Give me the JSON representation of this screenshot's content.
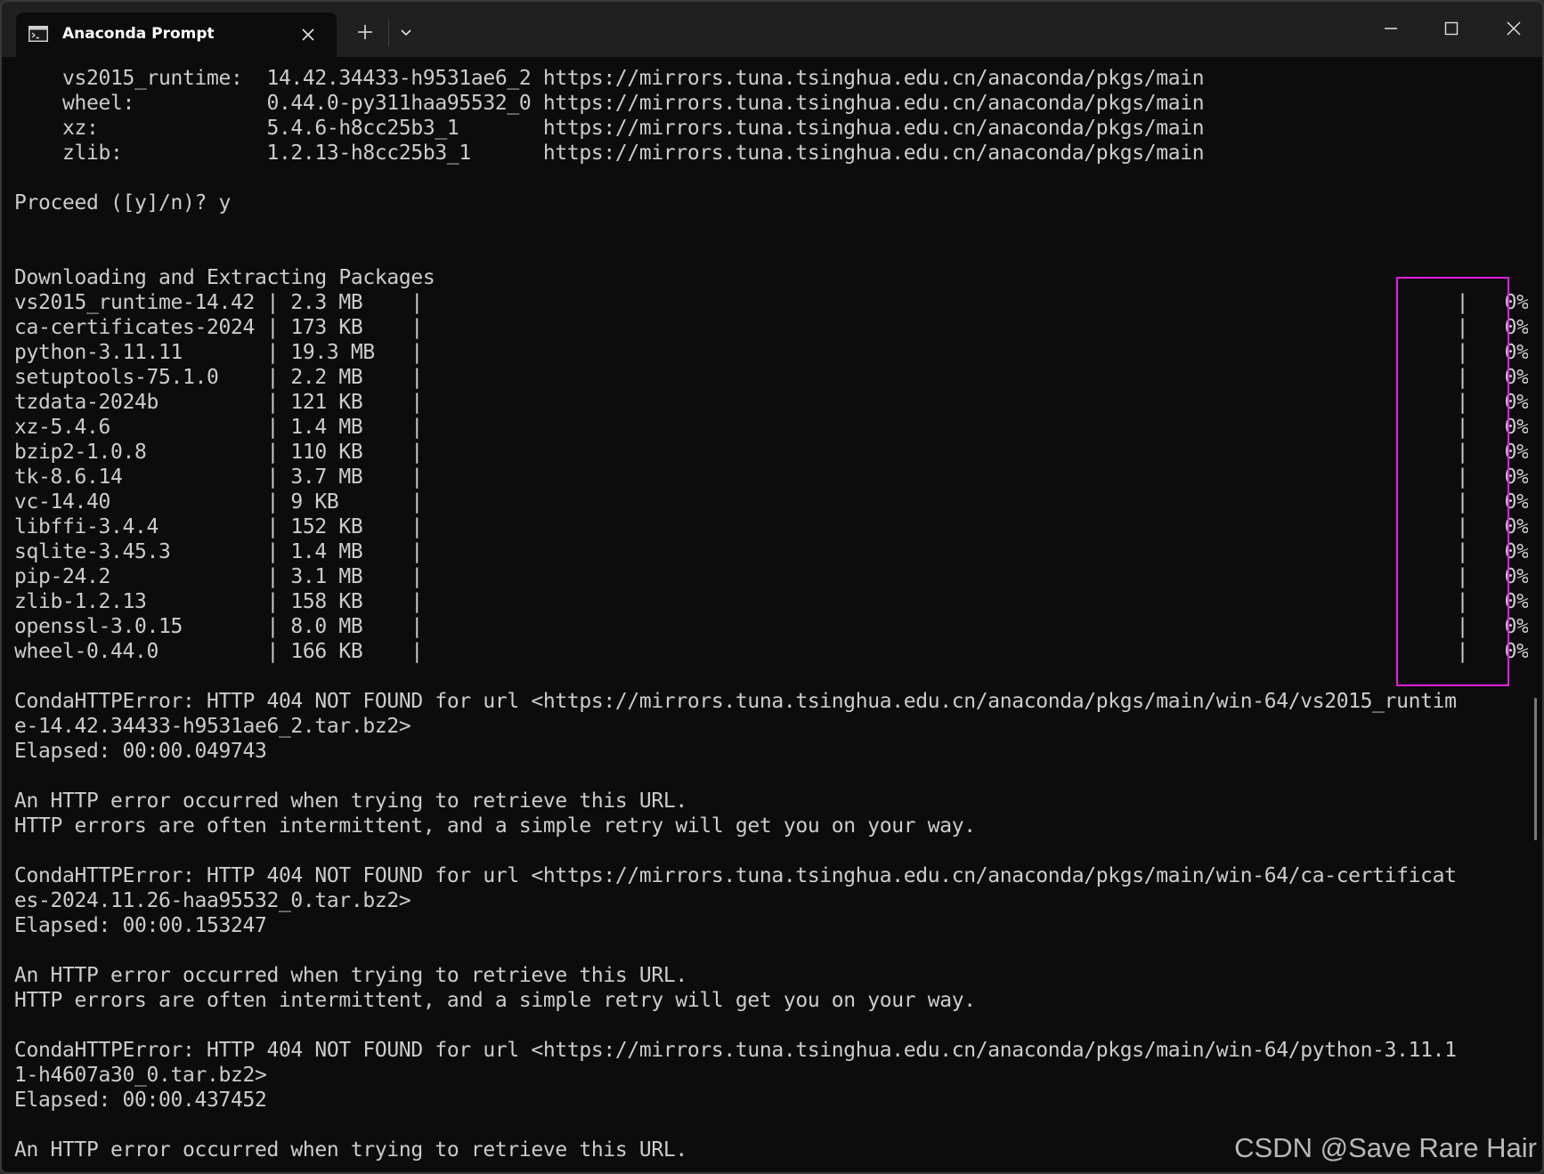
{
  "window": {
    "tab_title": "Anaconda Prompt",
    "tab_icon": "terminal-icon",
    "buttons": {
      "close_tab": "close-icon",
      "new_tab": "plus-icon",
      "dropdown": "chevron-down-icon",
      "minimize": "minimize-icon",
      "maximize": "maximize-icon",
      "close_window": "close-icon"
    }
  },
  "terminal": {
    "lines": [
      "    vs2015_runtime:  14.42.34433-h9531ae6_2 https://mirrors.tuna.tsinghua.edu.cn/anaconda/pkgs/main",
      "    wheel:           0.44.0-py311haa95532_0 https://mirrors.tuna.tsinghua.edu.cn/anaconda/pkgs/main",
      "    xz:              5.4.6-h8cc25b3_1       https://mirrors.tuna.tsinghua.edu.cn/anaconda/pkgs/main",
      "    zlib:            1.2.13-h8cc25b3_1      https://mirrors.tuna.tsinghua.edu.cn/anaconda/pkgs/main",
      "",
      "Proceed ([y]/n)? y",
      "",
      "",
      "Downloading and Extracting Packages",
      "vs2015_runtime-14.42 | 2.3 MB    |                                                                                      |   0%",
      "ca-certificates-2024 | 173 KB    |                                                                                      |   0%",
      "python-3.11.11       | 19.3 MB   |                                                                                      |   0%",
      "setuptools-75.1.0    | 2.2 MB    |                                                                                      |   0%",
      "tzdata-2024b         | 121 KB    |                                                                                      |   0%",
      "xz-5.4.6             | 1.4 MB    |                                                                                      |   0%",
      "bzip2-1.0.8          | 110 KB    |                                                                                      |   0%",
      "tk-8.6.14            | 3.7 MB    |                                                                                      |   0%",
      "vc-14.40             | 9 KB      |                                                                                      |   0%",
      "libffi-3.4.4         | 152 KB    |                                                                                      |   0%",
      "sqlite-3.45.3        | 1.4 MB    |                                                                                      |   0%",
      "pip-24.2             | 3.1 MB    |                                                                                      |   0%",
      "zlib-1.2.13          | 158 KB    |                                                                                      |   0%",
      "openssl-3.0.15       | 8.0 MB    |                                                                                      |   0%",
      "wheel-0.44.0         | 166 KB    |                                                                                      |   0%",
      "",
      "CondaHTTPError: HTTP 404 NOT FOUND for url <https://mirrors.tuna.tsinghua.edu.cn/anaconda/pkgs/main/win-64/vs2015_runtim",
      "e-14.42.34433-h9531ae6_2.tar.bz2>",
      "Elapsed: 00:00.049743",
      "",
      "An HTTP error occurred when trying to retrieve this URL.",
      "HTTP errors are often intermittent, and a simple retry will get you on your way.",
      "",
      "CondaHTTPError: HTTP 404 NOT FOUND for url <https://mirrors.tuna.tsinghua.edu.cn/anaconda/pkgs/main/win-64/ca-certificat",
      "es-2024.11.26-haa95532_0.tar.bz2>",
      "Elapsed: 00:00.153247",
      "",
      "An HTTP error occurred when trying to retrieve this URL.",
      "HTTP errors are often intermittent, and a simple retry will get you on your way.",
      "",
      "CondaHTTPError: HTTP 404 NOT FOUND for url <https://mirrors.tuna.tsinghua.edu.cn/anaconda/pkgs/main/win-64/python-3.11.1",
      "1-h4607a30_0.tar.bz2>",
      "Elapsed: 00:00.437452",
      "",
      "An HTTP error occurred when trying to retrieve this URL."
    ]
  },
  "annotation": {
    "color": "#e020e0"
  },
  "watermark": "CSDN @Save Rare Hair",
  "colors": {
    "terminal_bg": "#0c0c0c",
    "terminal_fg": "#cccccc",
    "titlebar_bg": "#202020"
  }
}
